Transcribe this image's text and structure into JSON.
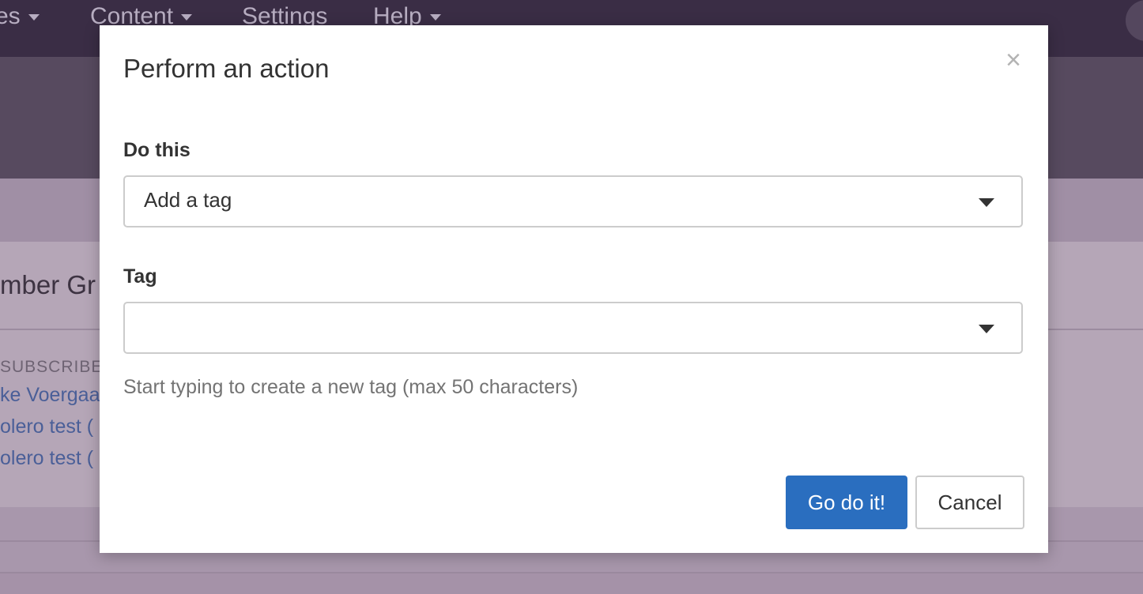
{
  "background": {
    "nav": [
      "es",
      "Content",
      "Settings",
      "Help"
    ],
    "panel_title": "mber Gr",
    "subscribers_heading": "SUBSCRIBER",
    "subscriber_links": [
      "ke Voergaa",
      "olero test (",
      "olero test ("
    ]
  },
  "modal": {
    "title": "Perform an action",
    "close_glyph": "×",
    "action_label": "Do this",
    "action_value": "Add a tag",
    "tag_label": "Tag",
    "tag_value": "",
    "help_text": "Start typing to create a new tag (max 50 characters)",
    "submit_label": "Go do it!",
    "cancel_label": "Cancel"
  },
  "colors": {
    "primary": "#2a6ebf",
    "nav_bg": "#3a2d45",
    "overlay_bg": "#a592a8"
  }
}
